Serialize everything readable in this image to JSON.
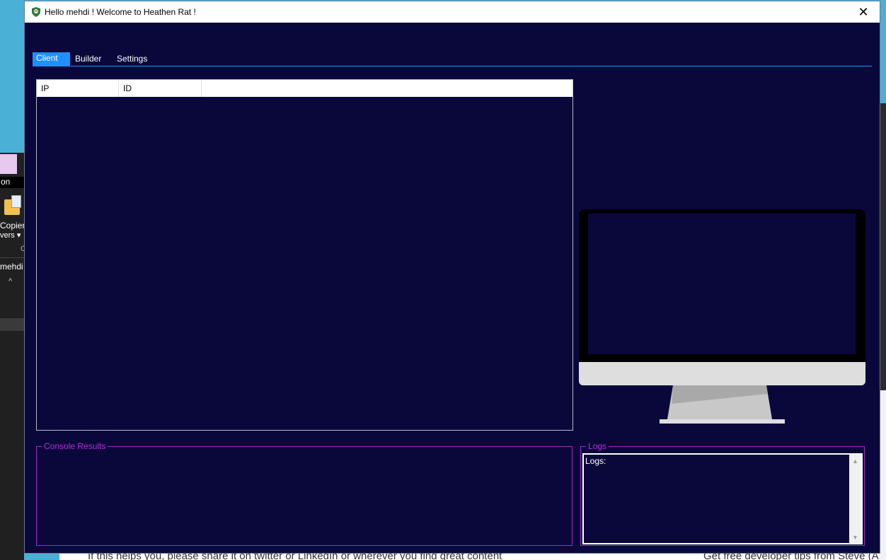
{
  "window": {
    "title": "Hello mehdi ! Welcome to Heathen Rat !",
    "close_symbol": "✕"
  },
  "tabs": [
    {
      "label": "Client",
      "active": true
    },
    {
      "label": "Builder",
      "active": false
    },
    {
      "label": "Settings",
      "active": false
    }
  ],
  "client_list": {
    "columns": [
      "IP",
      "ID",
      ""
    ],
    "rows": []
  },
  "console": {
    "label": "Console Results"
  },
  "logs": {
    "label": "Logs",
    "text": "Logs:"
  },
  "background": {
    "ribbon_text": "on",
    "folder_label": "Copier",
    "folder_sublabel": "vers ▾",
    "c_char": "C",
    "user_folder": "mehdi",
    "caret": "^",
    "page_text_left": "If this helps you, please share it on twitter or LinkedIn or wherever you find great content",
    "page_text_right": "Get free developer tips from Steve (A"
  },
  "colors": {
    "window_bg": "#0a083b",
    "accent": "#1e90ff",
    "groupbox_border": "#9b2fbf",
    "groupbox_text": "#b52fd6"
  }
}
